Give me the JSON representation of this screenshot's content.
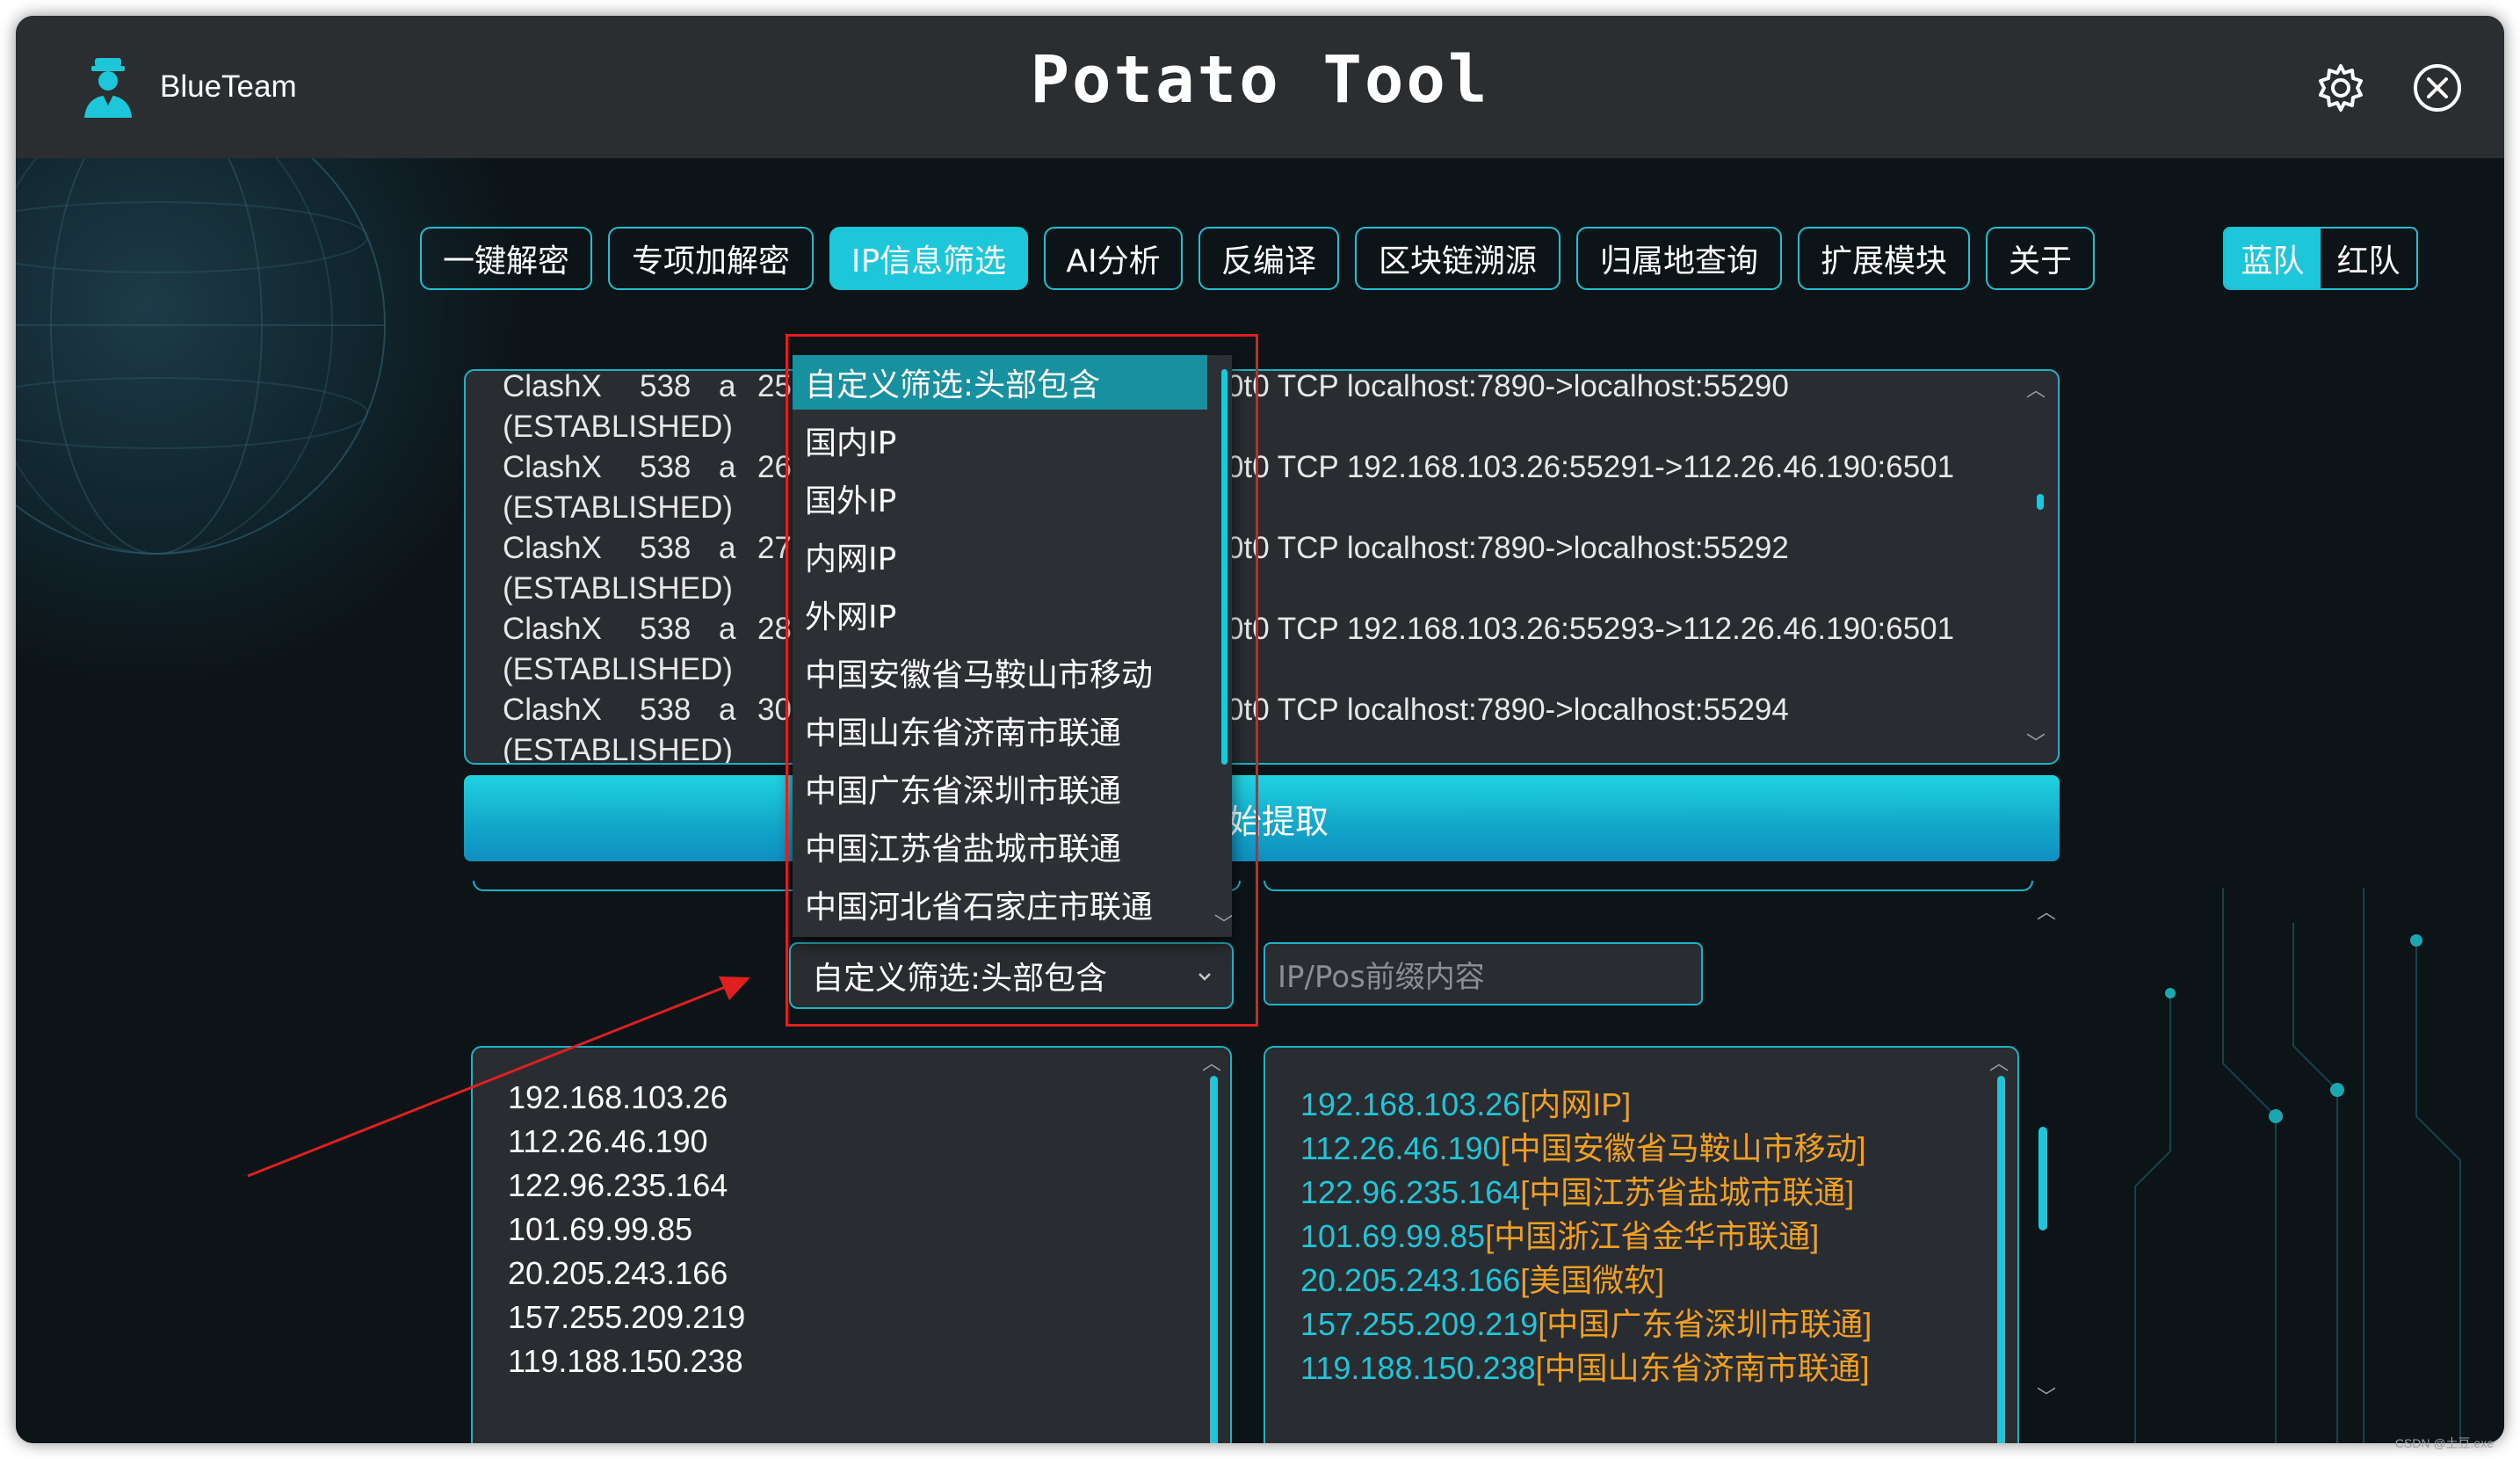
{
  "app": {
    "brand_name": "BlueTeam",
    "title": "Potato Tool"
  },
  "tabs": [
    {
      "label": "一键解密"
    },
    {
      "label": "专项加解密"
    },
    {
      "label": "IP信息筛选",
      "active": true
    },
    {
      "label": "AI分析"
    },
    {
      "label": "反编译"
    },
    {
      "label": "区块链溯源"
    },
    {
      "label": "归属地查询"
    },
    {
      "label": "扩展模块"
    },
    {
      "label": "关于"
    }
  ],
  "team_toggle": {
    "blue": "蓝队",
    "red": "红队",
    "active": "blue"
  },
  "output_lines": [
    {
      "proc": "ClashX",
      "pid": "538",
      "user": "a",
      "fd": "25",
      "tail": "0t0  TCP localhost:7890->localhost:55290"
    },
    {
      "proc": "(ESTABLISHED)"
    },
    {
      "proc": "ClashX",
      "pid": "538",
      "user": "a",
      "fd": "26",
      "tail": "0t0  TCP 192.168.103.26:55291->112.26.46.190:6501"
    },
    {
      "proc": "(ESTABLISHED)"
    },
    {
      "proc": "ClashX",
      "pid": "538",
      "user": "a",
      "fd": "27",
      "tail": "0t0  TCP localhost:7890->localhost:55292"
    },
    {
      "proc": "(ESTABLISHED)"
    },
    {
      "proc": "ClashX",
      "pid": "538",
      "user": "a",
      "fd": "28",
      "tail": "0t0  TCP 192.168.103.26:55293->112.26.46.190:6501"
    },
    {
      "proc": "(ESTABLISHED)"
    },
    {
      "proc": "ClashX",
      "pid": "538",
      "user": "a",
      "fd": "30",
      "tail": "0t0  TCP localhost:7890->localhost:55294"
    },
    {
      "proc": "(ESTABLISHED)"
    }
  ],
  "extract_button": "开始提取",
  "filter": {
    "selected": "自定义筛选:头部包含",
    "options": [
      "自定义筛选:头部包含",
      "国内IP",
      "国外IP",
      "内网IP",
      "外网IP",
      "中国安徽省马鞍山市移动",
      "中国山东省济南市联通",
      "中国广东省深圳市联通",
      "中国江苏省盐城市联通",
      "中国河北省石家庄市联通"
    ]
  },
  "prefix_input": {
    "placeholder": "IP/Pos前缀内容",
    "value": ""
  },
  "ip_list": [
    "192.168.103.26",
    "112.26.46.190",
    "122.96.235.164",
    "101.69.99.85",
    "20.205.243.166",
    "157.255.209.219",
    "119.188.150.238"
  ],
  "ip_locations": [
    {
      "ip": "192.168.103.26",
      "loc": "[内网IP]"
    },
    {
      "ip": "112.26.46.190",
      "loc": "[中国安徽省马鞍山市移动]"
    },
    {
      "ip": "122.96.235.164",
      "loc": "[中国江苏省盐城市联通]"
    },
    {
      "ip": "101.69.99.85",
      "loc": "[中国浙江省金华市联通]"
    },
    {
      "ip": "20.205.243.166",
      "loc": "[美国微软]"
    },
    {
      "ip": "157.255.209.219",
      "loc": "[中国广东省深圳市联通]"
    },
    {
      "ip": "119.188.150.238",
      "loc": "[中国山东省济南市联通]"
    }
  ],
  "watermark": "CSDN @土豆.exe",
  "colors": {
    "accent": "#1ec6da",
    "location": "#f0a021",
    "annotation": "#e11f1f"
  }
}
